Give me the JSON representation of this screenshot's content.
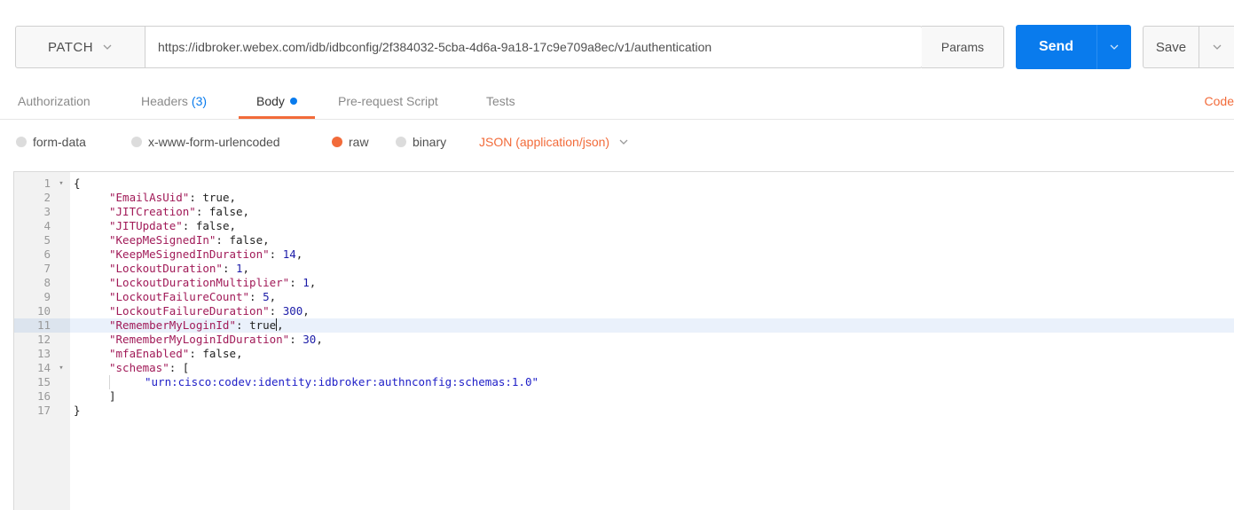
{
  "request": {
    "method": "PATCH",
    "url": "https://idbroker.webex.com/idb/idbconfig/2f384032-5cba-4d6a-9a18-17c9e709a8ec/v1/authentication",
    "params_label": "Params",
    "send_label": "Send",
    "save_label": "Save"
  },
  "tabs": [
    {
      "label": "Authorization"
    },
    {
      "label": "Headers",
      "count": "(3)"
    },
    {
      "label": "Body"
    },
    {
      "label": "Pre-request Script"
    },
    {
      "label": "Tests"
    }
  ],
  "code_link": "Code",
  "body_options": {
    "form_data": "form-data",
    "urlencoded": "x-www-form-urlencoded",
    "raw": "raw",
    "binary": "binary",
    "content_type": "JSON (application/json)"
  },
  "editor": {
    "highlighted_line": 11,
    "lines": [
      {
        "n": "1",
        "fold": true,
        "indent": 0,
        "tokens": [
          {
            "t": "{",
            "c": "p"
          }
        ]
      },
      {
        "n": "2",
        "indent": 1,
        "tokens": [
          {
            "t": "\"EmailAsUid\"",
            "c": "k"
          },
          {
            "t": ": ",
            "c": "p"
          },
          {
            "t": "true",
            "c": "b"
          },
          {
            "t": ",",
            "c": "p"
          }
        ]
      },
      {
        "n": "3",
        "indent": 1,
        "tokens": [
          {
            "t": "\"JITCreation\"",
            "c": "k"
          },
          {
            "t": ": ",
            "c": "p"
          },
          {
            "t": "false",
            "c": "b"
          },
          {
            "t": ",",
            "c": "p"
          }
        ]
      },
      {
        "n": "4",
        "indent": 1,
        "tokens": [
          {
            "t": "\"JITUpdate\"",
            "c": "k"
          },
          {
            "t": ": ",
            "c": "p"
          },
          {
            "t": "false",
            "c": "b"
          },
          {
            "t": ",",
            "c": "p"
          }
        ]
      },
      {
        "n": "5",
        "indent": 1,
        "tokens": [
          {
            "t": "\"KeepMeSignedIn\"",
            "c": "k"
          },
          {
            "t": ": ",
            "c": "p"
          },
          {
            "t": "false",
            "c": "b"
          },
          {
            "t": ",",
            "c": "p"
          }
        ]
      },
      {
        "n": "6",
        "indent": 1,
        "tokens": [
          {
            "t": "\"KeepMeSignedInDuration\"",
            "c": "k"
          },
          {
            "t": ": ",
            "c": "p"
          },
          {
            "t": "14",
            "c": "n"
          },
          {
            "t": ",",
            "c": "p"
          }
        ]
      },
      {
        "n": "7",
        "indent": 1,
        "tokens": [
          {
            "t": "\"LockoutDuration\"",
            "c": "k"
          },
          {
            "t": ": ",
            "c": "p"
          },
          {
            "t": "1",
            "c": "n"
          },
          {
            "t": ",",
            "c": "p"
          }
        ]
      },
      {
        "n": "8",
        "indent": 1,
        "tokens": [
          {
            "t": "\"LockoutDurationMultiplier\"",
            "c": "k"
          },
          {
            "t": ": ",
            "c": "p"
          },
          {
            "t": "1",
            "c": "n"
          },
          {
            "t": ",",
            "c": "p"
          }
        ]
      },
      {
        "n": "9",
        "indent": 1,
        "tokens": [
          {
            "t": "\"LockoutFailureCount\"",
            "c": "k"
          },
          {
            "t": ": ",
            "c": "p"
          },
          {
            "t": "5",
            "c": "n"
          },
          {
            "t": ",",
            "c": "p"
          }
        ]
      },
      {
        "n": "10",
        "indent": 1,
        "tokens": [
          {
            "t": "\"LockoutFailureDuration\"",
            "c": "k"
          },
          {
            "t": ": ",
            "c": "p"
          },
          {
            "t": "300",
            "c": "n"
          },
          {
            "t": ",",
            "c": "p"
          }
        ]
      },
      {
        "n": "11",
        "indent": 1,
        "caret": true,
        "tokens": [
          {
            "t": "\"RememberMyLoginId\"",
            "c": "k"
          },
          {
            "t": ": ",
            "c": "p"
          },
          {
            "t": "true",
            "c": "b"
          },
          {
            "t": ",",
            "c": "p"
          }
        ]
      },
      {
        "n": "12",
        "indent": 1,
        "tokens": [
          {
            "t": "\"RememberMyLoginIdDuration\"",
            "c": "k"
          },
          {
            "t": ": ",
            "c": "p"
          },
          {
            "t": "30",
            "c": "n"
          },
          {
            "t": ",",
            "c": "p"
          }
        ]
      },
      {
        "n": "13",
        "indent": 1,
        "tokens": [
          {
            "t": "\"mfaEnabled\"",
            "c": "k"
          },
          {
            "t": ": ",
            "c": "p"
          },
          {
            "t": "false",
            "c": "b"
          },
          {
            "t": ",",
            "c": "p"
          }
        ]
      },
      {
        "n": "14",
        "fold": true,
        "indent": 1,
        "tokens": [
          {
            "t": "\"schemas\"",
            "c": "k"
          },
          {
            "t": ": [",
            "c": "p"
          }
        ]
      },
      {
        "n": "15",
        "indent": 2,
        "guide": true,
        "tokens": [
          {
            "t": "\"urn:cisco:codev:identity:idbroker:authnconfig:schemas:1.0\"",
            "c": "s"
          }
        ]
      },
      {
        "n": "16",
        "indent": 1,
        "tokens": [
          {
            "t": "]",
            "c": "p"
          }
        ]
      },
      {
        "n": "17",
        "indent": 0,
        "tokens": [
          {
            "t": "}",
            "c": "p"
          }
        ]
      }
    ]
  },
  "colors": {
    "accent": "#f26b3a",
    "send_button": "#097bed",
    "tab_indicator": "#f26b3a"
  }
}
